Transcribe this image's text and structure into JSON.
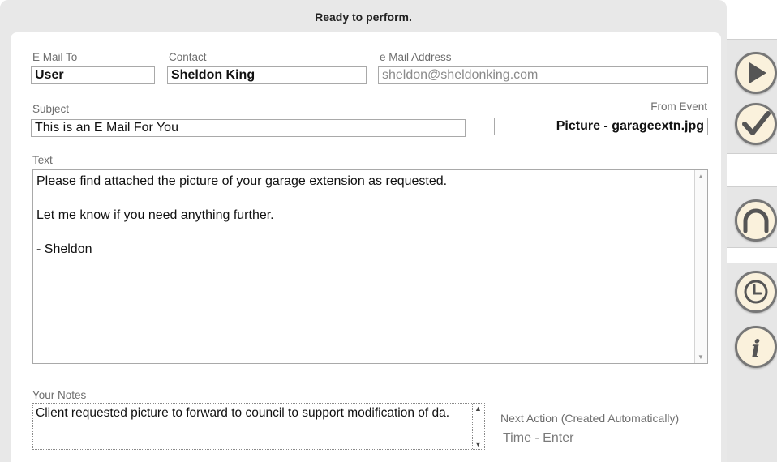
{
  "status": "Ready to perform.",
  "email_to": {
    "label": "E Mail To",
    "value": "User"
  },
  "contact": {
    "label": "Contact",
    "value": "Sheldon King"
  },
  "email_address": {
    "label": "e Mail Address",
    "value": "sheldon@sheldonking.com"
  },
  "subject": {
    "label": "Subject",
    "value": "This is an E Mail For You"
  },
  "from_event": {
    "label": "From Event",
    "value": "Picture - garageextn.jpg"
  },
  "text": {
    "label": "Text",
    "lines": [
      "Please find attached the picture of your garage extension as requested.",
      "Let me know if you need anything further.",
      "- Sheldon"
    ]
  },
  "notes": {
    "label": "Your Notes",
    "value": "Client requested picture to forward to council to support modification of da."
  },
  "next_action": {
    "label": "Next Action (Created Automatically)",
    "value": "Time - Enter"
  },
  "icons": {
    "play": "play-icon",
    "check": "check-icon",
    "arch": "arch-icon",
    "clock": "clock-icon",
    "info": "info-icon"
  },
  "colors": {
    "button_fill": "#faf1dc",
    "button_stroke": "#777777",
    "panel_bg": "#e8e8e8"
  }
}
